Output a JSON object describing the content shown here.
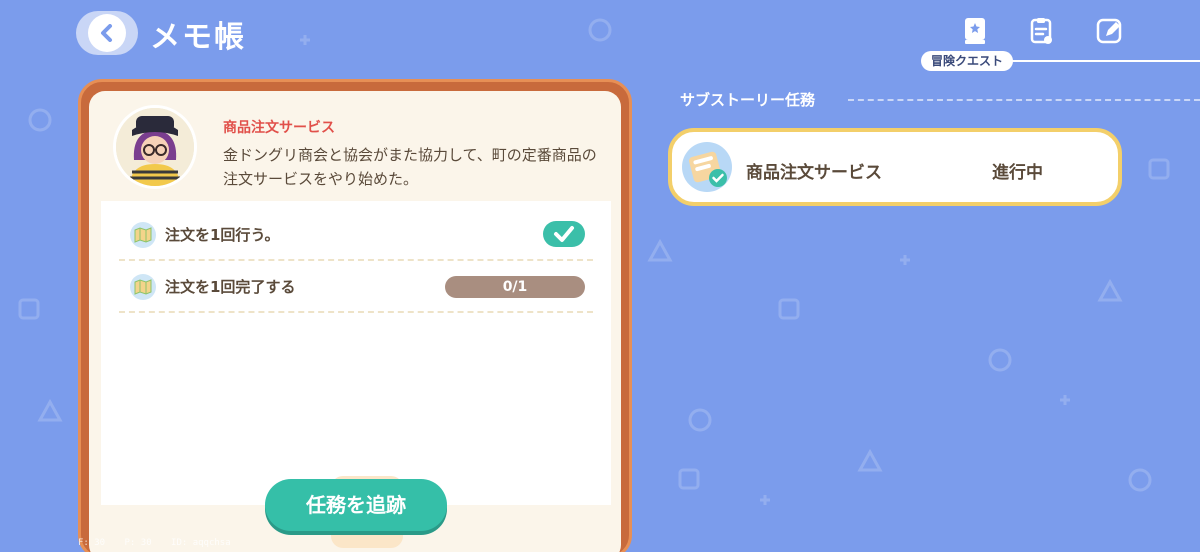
{
  "header": {
    "title": "メモ帳"
  },
  "tabs": {
    "active_label": "冒険クエスト"
  },
  "sidebar": {
    "section_label": "サブストーリー任務",
    "quest_item": {
      "name": "商品注文サービス",
      "status": "進行中"
    }
  },
  "quest": {
    "title": "商品注文サービス",
    "description": "金ドングリ商会と協会がまた協力して、町の定番商品の注文サービスをやり始めた。",
    "tasks": [
      {
        "text": "注文を1回行う。",
        "completed": true
      },
      {
        "text": "注文を1回完了する",
        "progress_text": "0/1",
        "progress": 0.0
      }
    ],
    "track_button": "任務を追跡"
  },
  "debug": {
    "f": "F: 30",
    "p": "P: 30",
    "id": "ID: aqqchsa"
  },
  "colors": {
    "background": "#7b9cec",
    "accent_teal": "#35bfa8",
    "card_border": "#c86a3c",
    "quest_title_red": "#e1504a",
    "selected_border": "#f3cf6a"
  }
}
